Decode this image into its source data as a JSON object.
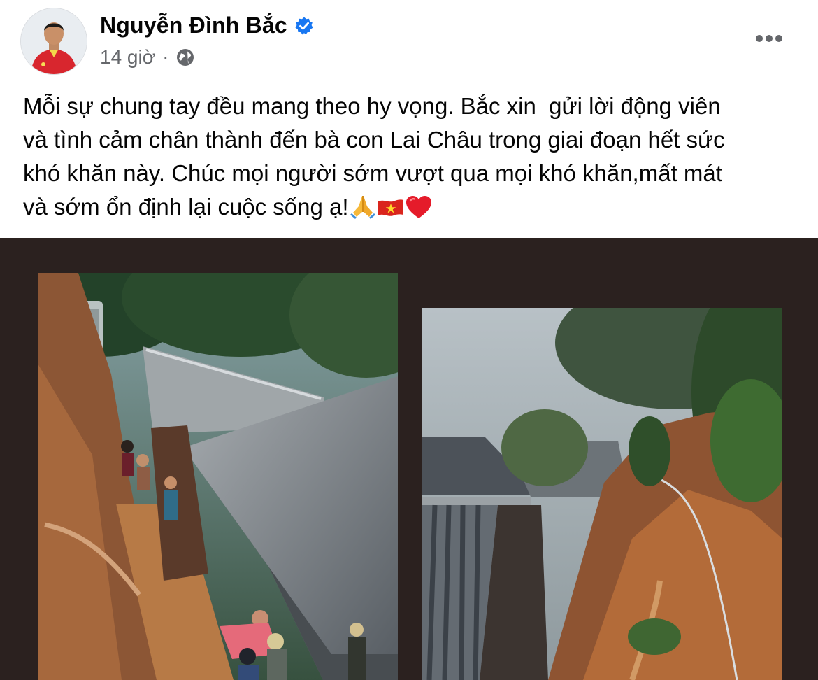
{
  "post": {
    "author": "Nguyễn Đình Bắc",
    "time": "14 giờ",
    "separator": "·",
    "visibility_icon": "globe-icon",
    "verified_icon": "verified-badge-icon",
    "more_icon": "more-options-icon",
    "text": "Mỗi sự chung tay đều mang theo hy vọng. Bắc xin  gửi lời động viên\nvà tình cảm chân thành đến bà con Lai Châu trong giai đoạn hết sức\nkhó khăn này. Chúc mọi người sớm vượt qua mọi khó khăn,mất mát\nvà sớm ổn định lại cuộc sống ạ!",
    "emojis": [
      "folded-hands-icon",
      "vietnam-flag-icon",
      "red-heart-icon"
    ]
  },
  "colors": {
    "name": "#050505",
    "meta": "#65676b",
    "verified": "#1877f2",
    "media_background": "#2b211f"
  }
}
